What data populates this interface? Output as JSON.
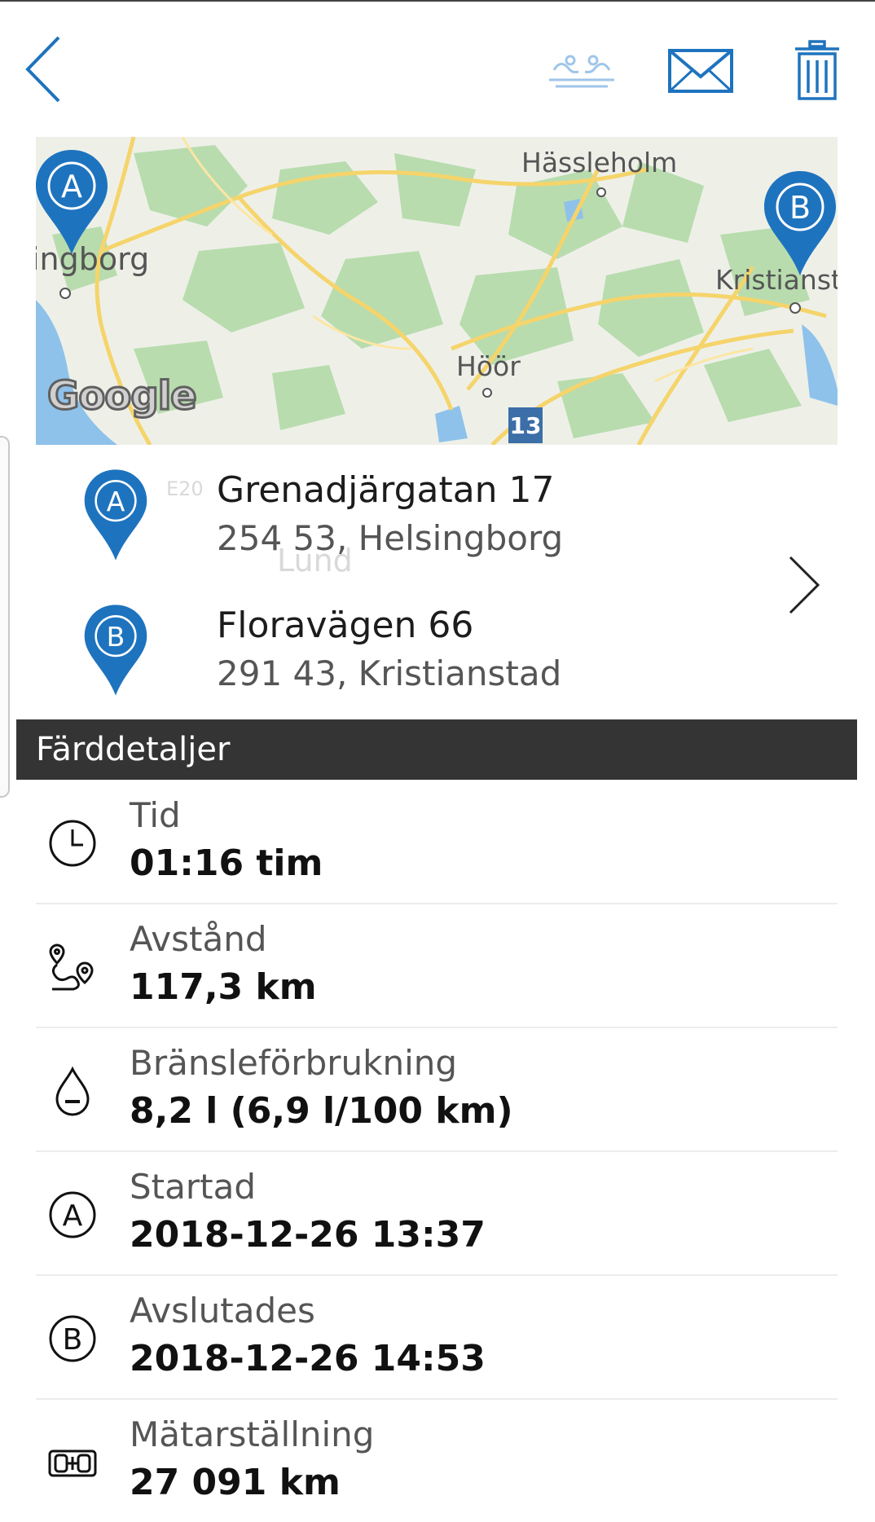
{
  "header": {
    "back_icon": "chevron-left-icon",
    "actions": [
      "car-share-icon",
      "mail-icon",
      "trash-icon"
    ],
    "accent_color": "#1e73be"
  },
  "map": {
    "labels": {
      "hassleholm": "Hässleholm",
      "helsingborg": "ingborg",
      "kristianstad": "Kristianst",
      "hoor": "Höör",
      "lund": "Lund",
      "e20": "E20"
    },
    "road_number": "13",
    "attribution": "Google",
    "pin_color": "#1e73be"
  },
  "route": {
    "start": {
      "marker": "A",
      "street": "Grenadjärgatan 17",
      "city": "254 53, Helsingborg"
    },
    "end": {
      "marker": "B",
      "street": "Floravägen 66",
      "city": "291 43, Kristianstad"
    }
  },
  "details": {
    "section_title": "Färddetaljer",
    "rows": [
      {
        "icon": "clock-icon",
        "label": "Tid",
        "value": "01:16 tim"
      },
      {
        "icon": "route-distance-icon",
        "label": "Avstånd",
        "value": "117,3 km"
      },
      {
        "icon": "fuel-drop-icon",
        "label": "Bränsleförbrukning",
        "value": "8,2 l (6,9 l/100 km)"
      },
      {
        "icon": "start-a-icon",
        "label": "Startad",
        "value": "2018-12-26 13:37"
      },
      {
        "icon": "end-b-icon",
        "label": "Avslutades",
        "value": "2018-12-26 14:53"
      },
      {
        "icon": "odometer-icon",
        "label": "Mätarställning",
        "value": "27 091 km"
      }
    ]
  }
}
